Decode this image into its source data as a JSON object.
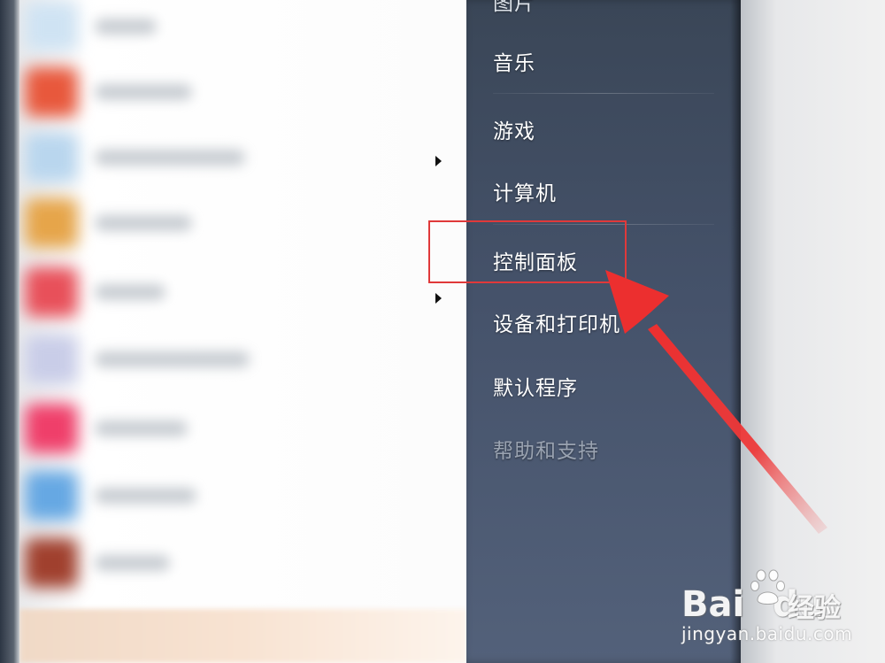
{
  "start_menu": {
    "items": [
      {
        "label": "图片",
        "state": "partially-visible"
      },
      {
        "label": "音乐"
      },
      {
        "label": "游戏"
      },
      {
        "label": "计算机"
      },
      {
        "label": "控制面板",
        "highlighted": true
      },
      {
        "label": "设备和打印机"
      },
      {
        "label": "默认程序"
      },
      {
        "label": "帮助和支持",
        "state": "dimmed"
      }
    ]
  },
  "program_list": {
    "icon_colors": [
      "#cfe3f3",
      "#e8583c",
      "#b9d6ee",
      "#e6a54a",
      "#e8505a",
      "#c9cde8",
      "#ef3f6a",
      "#66a8e3",
      "#a0402e"
    ]
  },
  "annotation": {
    "highlight_color": "#e0393a",
    "arrow_target": "控制面板"
  },
  "watermark": {
    "brand": "Bai",
    "brand_suffix": "du",
    "product": "经验",
    "url": "jingyan.baidu.com"
  }
}
